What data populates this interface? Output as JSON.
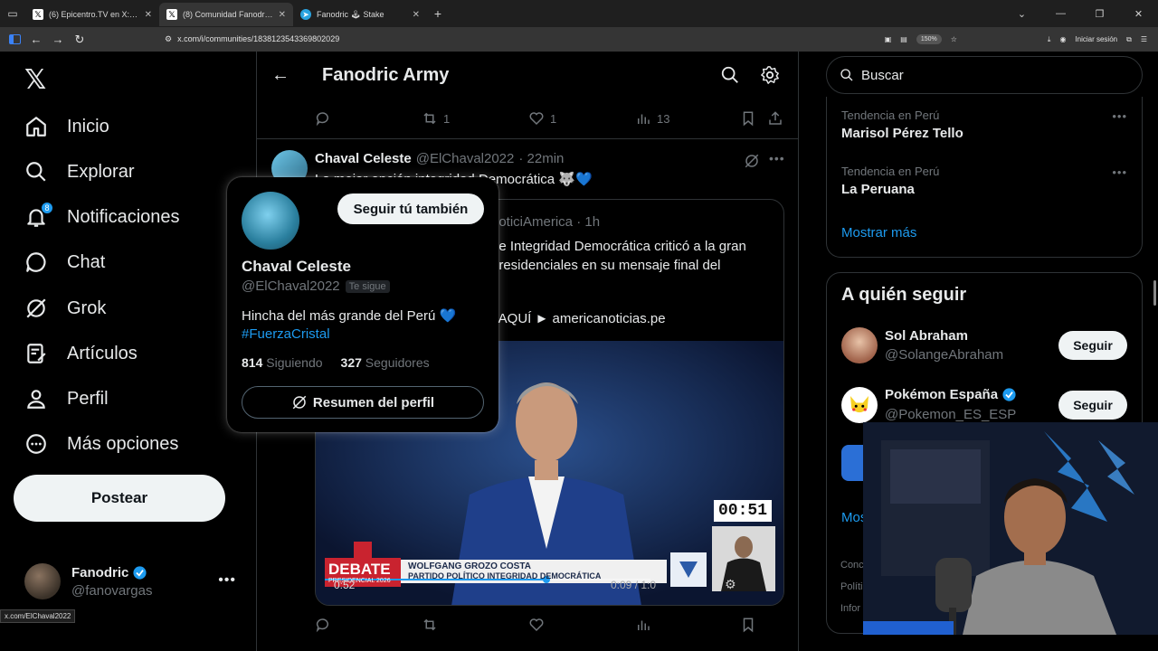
{
  "browser": {
    "tabs": [
      {
        "title": "(6) Epicentro.TV en X: \"#Debate",
        "icon": "X"
      },
      {
        "title": "(8) Comunidad Fanodric Army / X",
        "icon": "X"
      },
      {
        "title": "Fanodric 🕹 Stake",
        "icon": "telegram"
      }
    ],
    "url": "x.com/i/communities/1838123543369802029",
    "zoom": "150%",
    "signin": "Iniciar sesión",
    "status_url": "x.com/ElChaval2022"
  },
  "nav": {
    "items": [
      "Inicio",
      "Explorar",
      "Notificaciones",
      "Chat",
      "Grok",
      "Artículos",
      "Perfil",
      "Más opciones"
    ],
    "notif_count": "8",
    "post_label": "Postear"
  },
  "account": {
    "name": "Fanodric",
    "handle": "@fanovargas"
  },
  "community": {
    "title": "Fanodric Army"
  },
  "prev_tweet": {
    "replies": "",
    "retweets": "1",
    "likes": "1",
    "views": "13"
  },
  "tweet": {
    "name": "Chaval Celeste",
    "handle": "@ElChaval2022",
    "time": "· 22min",
    "text": "La mejor opción integridad Democrática 🐺💙"
  },
  "quote": {
    "header": "noticiAmerica · 1h",
    "text": "de Integridad Democrática criticó a la gran presidenciales en su mensaje final del",
    "link_text": "a AQUÍ ► americanoticias.pe"
  },
  "media": {
    "timer": "00:51",
    "debate_word": "DEBATE",
    "debate_sub": "PRESIDENCIAL 2026",
    "lower_name": "WOLFGANG GROZO COSTA",
    "lower_party": "PARTIDO POLÍTICO INTEGRIDAD DEMOCRÁTICA",
    "elapsed": "0:52",
    "duration": "0:09 / 1:0"
  },
  "hovercard": {
    "follow_label": "Seguir tú también",
    "name": "Chaval Celeste",
    "handle": "@ElChaval2022",
    "follows_you": "Te sigue",
    "bio": "Hincha del más grande del Perú 💙",
    "hashtag": "#FuerzaCristal",
    "following_count": "814",
    "following_label": "Siguiendo",
    "followers_count": "327",
    "followers_label": "Seguidores",
    "summary_label": "Resumen del perfil"
  },
  "right": {
    "search_placeholder": "Buscar",
    "trends": [
      {
        "context": "Tendencia en Perú",
        "title": "Marisol Pérez Tello"
      },
      {
        "context": "Tendencia en Perú",
        "title": "La Peruana"
      }
    ],
    "show_more": "Mostrar más",
    "wtf_title": "A quién seguir",
    "suggestions": [
      {
        "name": "Sol Abraham",
        "handle": "@SolangeAbraham",
        "verified": false,
        "button": "Seguir"
      },
      {
        "name": "Pokémon España",
        "handle": "@Pokemon_ES_ESP",
        "verified": true,
        "button": "Seguir"
      }
    ],
    "partial_more": "Mos",
    "footer": [
      "Conc",
      "Políti",
      "Infor"
    ]
  },
  "colors": {
    "accent": "#1d9bf0",
    "background": "#000000",
    "border": "#2f3336",
    "muted": "#71767b"
  }
}
